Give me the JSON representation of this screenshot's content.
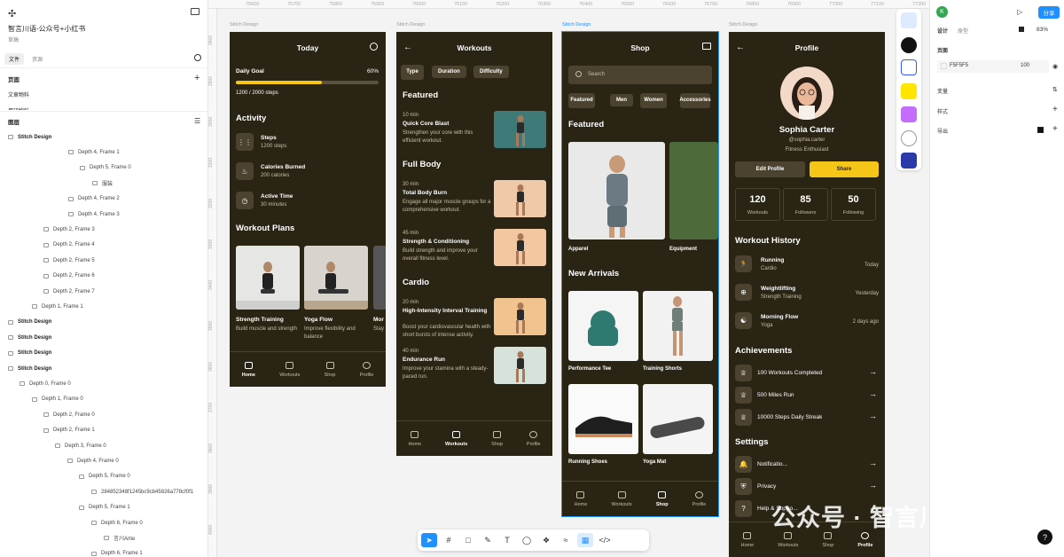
{
  "app": {
    "project_title": "智言川语-公众号+小红书",
    "project_sub": "草稿",
    "zoom": "83%",
    "share_label": "分享",
    "avatar_letter": "K"
  },
  "left": {
    "tabs": [
      "文件",
      "资源"
    ],
    "pages_label": "页面",
    "pages": [
      "文章物料",
      "用研物料"
    ],
    "layers_label": "图层",
    "layers": [
      "Stitch Design",
      "Depth 4, Frame 1",
      "Depth 5, Frame 0",
      "服装",
      "Depth 4, Frame 2",
      "Depth 4, Frame 3",
      "Depth 2, Frame 3",
      "Depth 2, Frame 4",
      "Depth 2, Frame 5",
      "Depth 2, Frame 6",
      "Depth 2, Frame 7",
      "Depth 1, Frame 1",
      "Stitch Design",
      "Stitch Design",
      "Stitch Design",
      "Stitch Design",
      "Depth 0, Frame 0",
      "Depth 1, Frame 0",
      "Depth 2, Frame 0",
      "Depth 2, Frame 1",
      "Depth 3, Frame 0",
      "Depth 4, Frame 0",
      "Depth 5, Frame 0",
      "284852348f1245bc9cb45826a778cf0f1",
      "Depth 5, Frame 1",
      "Depth 6, Frame 0",
      "言川Artie",
      "Depth 6, Frame 1"
    ]
  },
  "ruler": {
    "top": [
      "75600",
      "75700",
      "75800",
      "75900",
      "76000",
      "76100",
      "76200",
      "76300",
      "76400",
      "76500",
      "76600",
      "76700",
      "76800",
      "76900",
      "77000",
      "77100",
      "77200"
    ],
    "left": [
      "2800",
      "2900",
      "3000",
      "3100",
      "3200",
      "3300",
      "3400",
      "3500",
      "3600",
      "3700",
      "3800",
      "3900",
      "4000"
    ]
  },
  "frame_label": "Stitch Design",
  "today": {
    "title": "Today",
    "goal_label": "Daily Goal",
    "goal_pct": "60%",
    "goal_progress": 0.6,
    "steps_text": "1200 / 2000 steps",
    "activity": "Activity",
    "items": [
      {
        "title": "Steps",
        "sub": "1200 steps",
        "icon": "footprint-icon"
      },
      {
        "title": "Calories Burned",
        "sub": "200 calories",
        "icon": "flame-icon"
      },
      {
        "title": "Active Time",
        "sub": "30 minutes",
        "icon": "timer-icon"
      }
    ],
    "plans_label": "Workout Plans",
    "plans": [
      {
        "title": "Strength Training",
        "sub": "Build muscle and strength"
      },
      {
        "title": "Yoga Flow",
        "sub": "Improve flexibility and balance"
      },
      {
        "title": "Mor",
        "sub": "Stay ener"
      }
    ]
  },
  "workouts": {
    "title": "Workouts",
    "chips": [
      "Type",
      "Duration",
      "Difficulty"
    ],
    "sections": [
      {
        "name": "Featured",
        "items": [
          {
            "time": "10 min",
            "title": "Quick Core Blast",
            "desc": "Strengthen your core with this efficient workout."
          }
        ]
      },
      {
        "name": "Full Body",
        "items": [
          {
            "time": "30 min",
            "title": "Total Body Burn",
            "desc": "Engage all major muscle groups for a comprehensive workout."
          },
          {
            "time": "45 min",
            "title": "Strength & Conditioning",
            "desc": "Build strength and improve your overall fitness level."
          }
        ]
      },
      {
        "name": "Cardio",
        "items": [
          {
            "time": "20 min",
            "title": "High-Intensity Interval Training",
            "desc": "Boost your cardiovascular health with short bursts of intense activity."
          },
          {
            "time": "40 min",
            "title": "Endurance Run",
            "desc": "Improve your stamina with a steady-paced run."
          }
        ]
      }
    ]
  },
  "shop": {
    "title": "Shop",
    "search_placeholder": "Search",
    "chips": [
      "Featured",
      "Men",
      "Women",
      "Accessories"
    ],
    "featured_label": "Featured",
    "featured": [
      "Apparel",
      "Equipment"
    ],
    "new_label": "New Arrivals",
    "products": [
      "Performance Tee",
      "Training Shorts",
      "Running Shoes",
      "Yoga Mat"
    ]
  },
  "profile": {
    "title": "Profile",
    "name": "Sophia Carter",
    "handle": "@sophia.carter",
    "bio": "Fitness Enthusiast",
    "edit": "Edit Profile",
    "share": "Share",
    "stats": [
      {
        "n": "120",
        "l": "Workouts"
      },
      {
        "n": "85",
        "l": "Followers"
      },
      {
        "n": "50",
        "l": "Following"
      }
    ],
    "history_label": "Workout History",
    "history": [
      {
        "t": "Running",
        "s": "Cardio",
        "d": "Today"
      },
      {
        "t": "Weightlifting",
        "s": "Strength Training",
        "d": "Yesterday"
      },
      {
        "t": "Morning Flow",
        "s": "Yoga",
        "d": "2 days ago"
      }
    ],
    "ach_label": "Achievements",
    "ach": [
      "100 Workouts Completed",
      "500 Miles Run",
      "10000 Steps Daily Streak"
    ],
    "settings_label": "Settings",
    "settings": [
      "Notificatio...",
      "Privacy",
      "Help & Suppo..."
    ]
  },
  "nav": [
    "Home",
    "Workouts",
    "Shop",
    "Profile"
  ],
  "right": {
    "tabs": [
      "设计",
      "原型"
    ],
    "page_label": "页面",
    "bg": "F5F5F5",
    "bg_pct": "100",
    "var": "变量",
    "style": "样式",
    "export": "导出"
  },
  "watermark": "公众号 · 智言川语",
  "help": "?",
  "colors": {
    "accent": "#f5c518",
    "frame_bg": "#2a2414",
    "chip": "#4b4330",
    "selection": "#1e90ff"
  }
}
